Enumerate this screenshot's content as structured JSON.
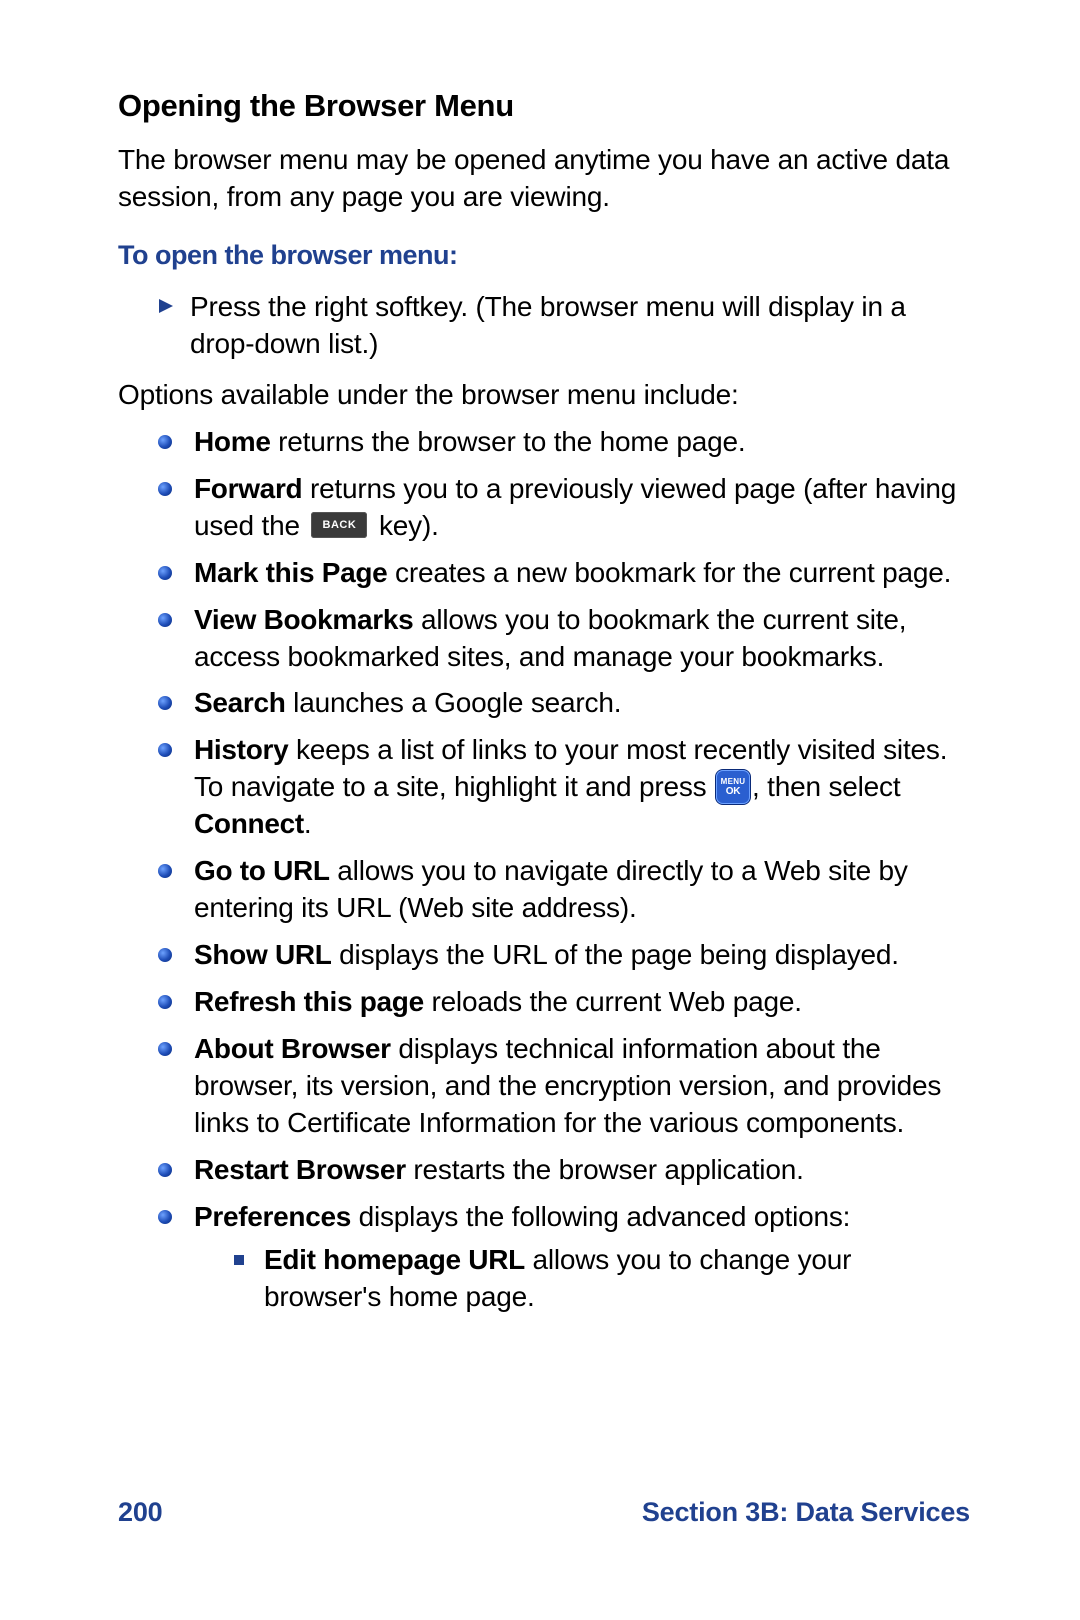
{
  "heading": "Opening the Browser Menu",
  "intro": "The browser menu may be opened anytime you have an active data session, from any page you are viewing.",
  "subhead": "To open the browser menu:",
  "step": "Press the right softkey. (The browser menu will display in a drop-down list.)",
  "options_lead": "Options available under the browser menu include:",
  "items": [
    {
      "term": "Home",
      "desc": " returns the browser to the home page."
    },
    {
      "term": "Forward",
      "desc_before": " returns you to a previously viewed page (after having used the ",
      "key": "back",
      "desc_after": " key)."
    },
    {
      "term": "Mark this Page",
      "desc": " creates a new bookmark for the current page."
    },
    {
      "term": "View Bookmarks",
      "desc": " allows you to bookmark the current site, access bookmarked sites, and manage your bookmarks."
    },
    {
      "term": "Search",
      "desc": " launches a Google search."
    },
    {
      "term": "History",
      "desc_before": " keeps a list of links to your most recently visited sites. To navigate to a site, highlight it and press ",
      "key": "menuok",
      "desc_mid": ", then select ",
      "bold2": "Connect",
      "desc_after": "."
    },
    {
      "term": "Go to URL",
      "desc": " allows you to navigate directly to a Web site by entering its URL (Web site address)."
    },
    {
      "term": "Show URL",
      "desc": " displays the URL of the page being displayed."
    },
    {
      "term": "Refresh this page",
      "desc": " reloads the current Web page."
    },
    {
      "term": "About Browser",
      "desc": " displays technical information about the browser, its version, and the encryption version, and provides links to Certificate Information for the various components."
    },
    {
      "term": "Restart Browser",
      "desc": " restarts the browser application."
    },
    {
      "term": "Preferences",
      "desc": " displays the following advanced options:"
    }
  ],
  "sub_item": {
    "term": "Edit homepage URL",
    "desc": " allows you to change your browser's home page."
  },
  "footer": {
    "page": "200",
    "section": "Section 3B: Data Services"
  },
  "key_back_label": "BACK",
  "key_menuok_l1": "MENU",
  "key_menuok_l2": "OK"
}
